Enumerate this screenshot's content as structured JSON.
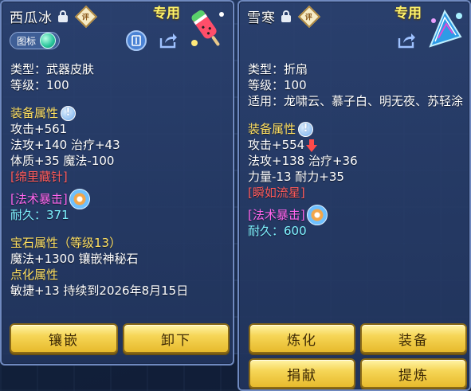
{
  "left_panel": {
    "item_name": "西瓜冰",
    "rate_badge": "评",
    "exclusive_tag": "专用",
    "icon_toggle_label": "图标",
    "lines": {
      "type": "类型：武器皮肤",
      "level": "等级：100",
      "equip_attr_title": "装备属性",
      "attack": "攻击+561",
      "magic_heal": "法攻+140 治疗+43",
      "con_mp": "体质+35 魔法-100",
      "special_effect": "[绵里藏针]",
      "skill": "[法术暴击]",
      "durability": "耐久：371",
      "gem_title": "宝石属性（等级13）",
      "gem_effect": "魔法+1300 镶嵌神秘石",
      "enchant_title": "点化属性",
      "enchant_effect": "敏捷+13 持续到2026年8月15日"
    },
    "buttons": {
      "inlay": "镶嵌",
      "unequip": "卸下"
    }
  },
  "right_panel": {
    "item_name": "雪寒",
    "rate_badge": "评",
    "exclusive_tag": "专用",
    "lines": {
      "type": "类型：折扇",
      "level": "等级：100",
      "applies": "适用：龙啸云、慕子白、明无夜、苏轻涂",
      "equip_attr_title": "装备属性",
      "attack": "攻击+554",
      "magic_heal": "法攻+138 治疗+36",
      "str_end": "力量-13 耐力+35",
      "special_effect": "[瞬如流星]",
      "skill": "[法术暴击]",
      "durability": "耐久：600"
    },
    "buttons": {
      "refine": "炼化",
      "equip": "装备",
      "donate": "捐献",
      "extract": "提炼"
    }
  },
  "colors": {
    "section_yellow": "#ffe062",
    "effect_red": "#ff5b5b",
    "skill_magenta": "#ff66ee",
    "durability_cyan": "#7ff2ff",
    "button_gold": "#f6d657"
  },
  "icons": [
    "lock-icon",
    "rate-icon",
    "item-thumbnail",
    "toggle-knob",
    "detail-icon",
    "share-icon",
    "info-icon",
    "skill-icon",
    "arrow-down-icon"
  ]
}
